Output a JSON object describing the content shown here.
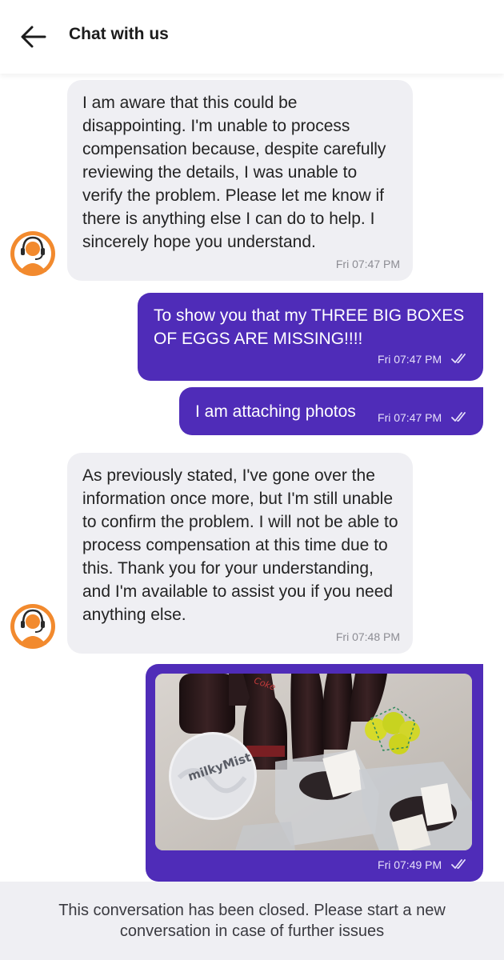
{
  "header": {
    "back_icon": "arrow-left-icon",
    "title": "Chat with us"
  },
  "messages": [
    {
      "direction": "incoming",
      "text": "I am aware that this could be disappointing. I'm unable to process compensation because, despite carefully reviewing the details, I was unable to verify the problem. Please let me know if there is anything else I can do to help. I sincerely hope you understand.",
      "time": "Fri 07:47 PM",
      "avatar_icon": "support-agent-headset-icon"
    },
    {
      "direction": "outgoing",
      "text": "To show you that my THREE BIG BOXES OF EGGS ARE MISSING!!!!",
      "time": "Fri 07:47 PM",
      "status_icon": "double-check-icon"
    },
    {
      "direction": "outgoing",
      "text": "I am attaching photos",
      "time": "Fri 07:47 PM",
      "status_icon": "double-check-icon"
    },
    {
      "direction": "incoming",
      "text": "As previously stated, I've gone over the information once more, but I'm still unable to confirm the problem. I will not be able to process compensation at this time due to this. Thank you for your understanding, and I'm available to assist you if you need anything else.",
      "time": "Fri 07:48 PM",
      "avatar_icon": "support-agent-headset-icon"
    },
    {
      "direction": "outgoing",
      "type": "image",
      "image": {
        "brand_label": "milkyMist",
        "bottle_label": "Coke"
      },
      "time": "Fri 07:49 PM",
      "status_icon": "double-check-icon"
    }
  ],
  "footer": {
    "closed_notice": "This conversation has been closed. Please start a new conversation in case of further issues"
  },
  "colors": {
    "outgoing_bubble": "#4f2cb8",
    "incoming_bubble": "#efeff3",
    "avatar_orange": "#f28a2e",
    "footer_bg": "#efeff3"
  }
}
